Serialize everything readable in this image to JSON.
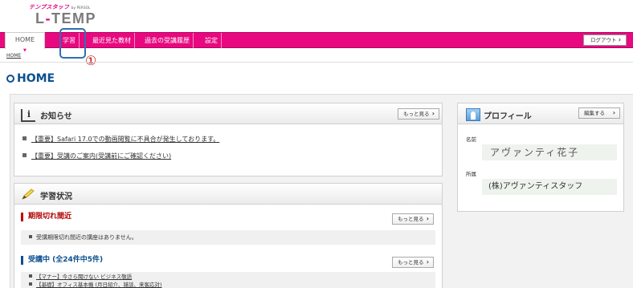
{
  "header": {
    "brand_top": "テンプスタッフ",
    "brand_by": "by PERSOL",
    "brand_left": "L",
    "brand_dash": "-",
    "brand_right": "TEMP"
  },
  "nav": {
    "home": "HOME",
    "items": [
      "学習",
      "最近見た教材",
      "過去の受講履歴",
      "設定"
    ],
    "logout": "ログアウト"
  },
  "annotation": {
    "number": "①"
  },
  "breadcrumb": "HOME",
  "page_title": "HOME",
  "news": {
    "title": "お知らせ",
    "more": "もっと見る",
    "items": [
      "【重要】Safari 17.0での動画閲覧に不具合が発生しております。",
      "【重要】受講のご案内(受講前にご確認ください)"
    ]
  },
  "learning": {
    "title": "学習状況",
    "expiring": {
      "heading": "期限切れ間近",
      "more": "もっと見る",
      "empty": "受講期限切れ間近の講座はありません。"
    },
    "in_progress": {
      "heading": "受講中 (全24件中5件)",
      "more": "もっと見る",
      "items": [
        "【マナー】今さら聞けない ビジネス敬語",
        "【基礎】オフィス基本機 (月日紹介、雑談、来客応対)"
      ]
    }
  },
  "profile": {
    "title": "プロフィール",
    "edit": "編集する",
    "name_label": "名前",
    "name": "アヴァンティ花子",
    "affiliation_label": "所属",
    "affiliation": "(株)アヴァンティスタッフ"
  },
  "colors": {
    "accent_pink": "#e8087f",
    "title_blue": "#0b4f8f",
    "alert_red": "#c00000",
    "annotation_blue": "#2e6fb4"
  }
}
